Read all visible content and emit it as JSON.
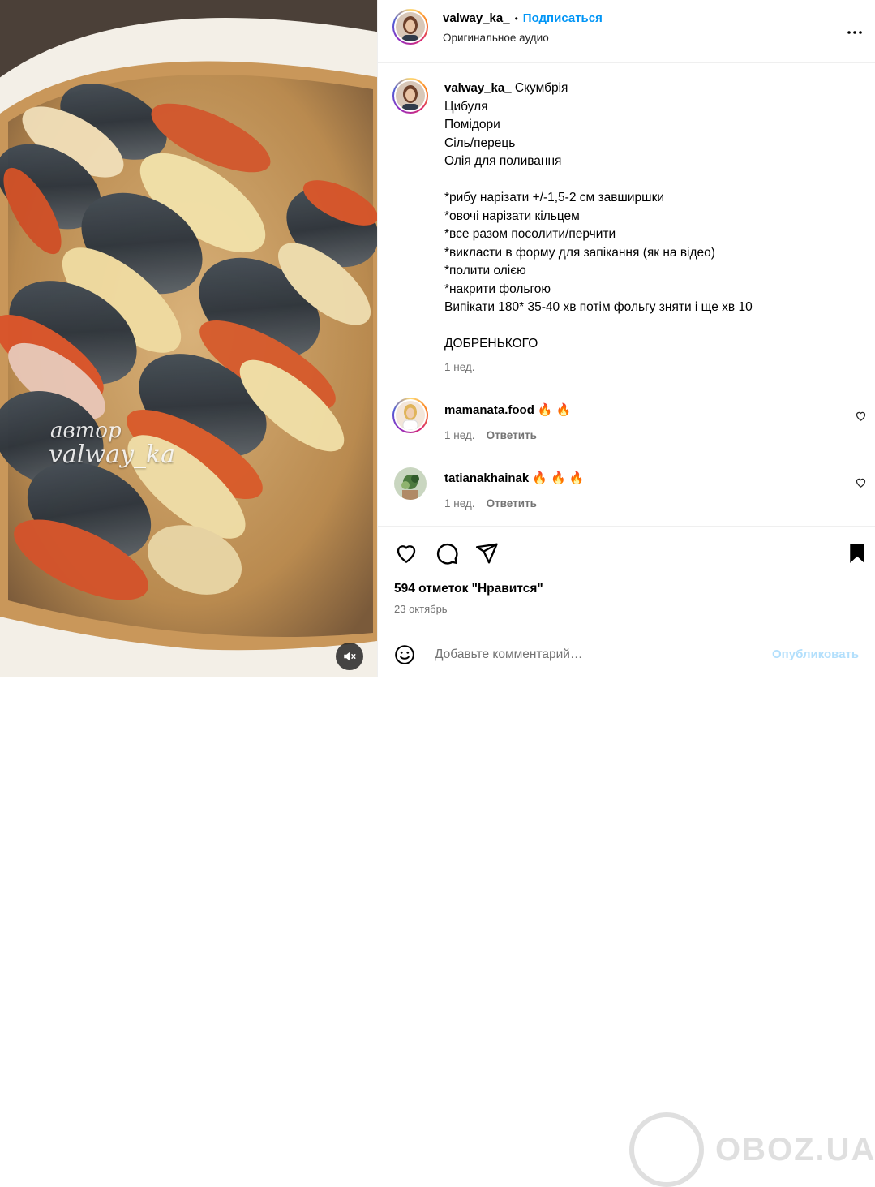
{
  "media": {
    "watermark_line1": "автор",
    "watermark_line2": "valway_ka",
    "mute_icon": "speaker-muted-icon"
  },
  "header": {
    "username": "valway_ka_",
    "separator": "•",
    "follow_label": "Подписаться",
    "audio_label": "Оригинальное аудио",
    "more_icon": "more-horizontal-icon"
  },
  "caption": {
    "username": "valway_ka_",
    "lines": [
      "Скумбрія",
      "Цибуля",
      "Помідори",
      "Сіль/перець",
      "Олія для поливання",
      "",
      "*рибу нарізати +/-1,5-2 см завширшки",
      "*овочі нарізати кільцем",
      "*все разом посолити/перчити",
      "*викласти в форму для запікання (як на відео)",
      "*полити олією",
      "*накрити фольгою",
      "Випікати 180* 35-40 хв потім фольгу зняти і ще хв 10",
      "",
      "ДОБРЕНЬКОГО"
    ],
    "time": "1 нед."
  },
  "comments": [
    {
      "username": "mamanata.food",
      "text": "🔥 🔥",
      "time": "1 нед.",
      "reply_label": "Ответить"
    },
    {
      "username": "tatianakhainak",
      "text": "🔥 🔥 🔥",
      "time": "1 нед.",
      "reply_label": "Ответить"
    }
  ],
  "actions": {
    "like_icon": "heart-icon",
    "comment_icon": "comment-icon",
    "share_icon": "share-icon",
    "save_icon": "bookmark-icon",
    "likes_text": "594 отметок \"Нравится\"",
    "date_text": "23 октябрь"
  },
  "footer": {
    "emoji_icon": "emoji-icon",
    "comment_placeholder": "Добавьте комментарий…",
    "publish_label": "Опубликовать"
  },
  "site_watermark": "OBOZ.UA",
  "colors": {
    "accent": "#0095f6",
    "publish_disabled": "#b2dffc",
    "secondary_text": "#737373",
    "divider": "#efefef"
  }
}
